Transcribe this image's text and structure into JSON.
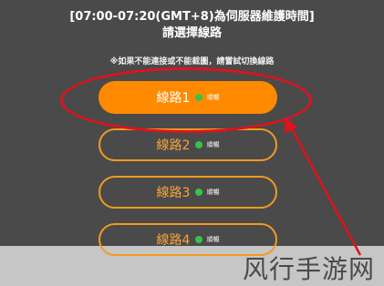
{
  "header": {
    "maintenance_time": "[07:00-07:20(GMT+8)為伺服器維護時間]",
    "instruction": "請選擇線路",
    "note": "※如果不能連接或不能截圖，請嘗試切換線路"
  },
  "routes": [
    {
      "label": "線路1",
      "status": "順暢",
      "selected": true
    },
    {
      "label": "線路2",
      "status": "順暢",
      "selected": false
    },
    {
      "label": "線路3",
      "status": "順暢",
      "selected": false
    },
    {
      "label": "線路4",
      "status": "順暢",
      "selected": false
    }
  ],
  "colors": {
    "background": "#4a4a4a",
    "accent": "#ff8a00",
    "status_dot": "#38c24a",
    "annotation": "#e0121b"
  },
  "watermark": "风行手游网"
}
